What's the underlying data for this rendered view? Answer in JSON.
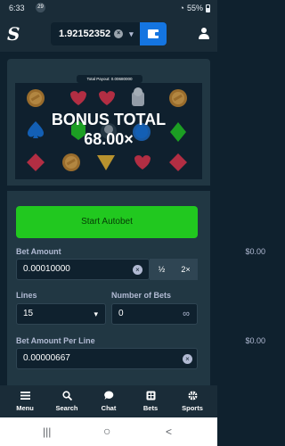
{
  "status_bar": {
    "time": "6:33",
    "notif": "29",
    "battery": "55%"
  },
  "wallet": {
    "balance": "1.92152352",
    "coin_glyph": "×"
  },
  "game": {
    "total_payout_label": "Total Payout: 0.00680000",
    "bonus_title": "BONUS TOTAL",
    "bonus_multiplier": "68.00×"
  },
  "controls": {
    "autobet_label": "Start Autobet",
    "bet_amount_label": "Bet Amount",
    "bet_amount_usd": "$0.00",
    "bet_amount_value": "0.00010000",
    "half_label": "½",
    "double_label": "2×",
    "lines_label": "Lines",
    "lines_value": "15",
    "number_of_bets_label": "Number of Bets",
    "number_of_bets_value": "0",
    "infinity_glyph": "∞",
    "bet_per_line_label": "Bet Amount Per Line",
    "bet_per_line_usd": "$0.00",
    "bet_per_line_value": "0.00000667"
  },
  "nav": {
    "menu": "Menu",
    "search": "Search",
    "chat": "Chat",
    "bets": "Bets",
    "sports": "Sports"
  },
  "android": {
    "recents": "|||",
    "home": "○",
    "back": "<"
  }
}
